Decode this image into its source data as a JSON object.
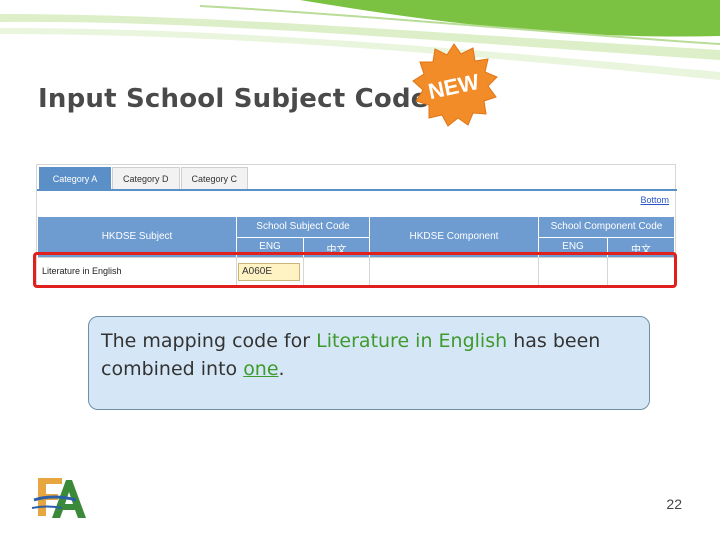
{
  "slide": {
    "title": "Input School Subject Code",
    "badge": "NEW",
    "page_number": "22"
  },
  "screen": {
    "tabs": [
      {
        "label": "Category A",
        "active": true
      },
      {
        "label": "Category D",
        "active": false
      },
      {
        "label": "Category C",
        "active": false
      }
    ],
    "bottom_link": "Bottom",
    "headers": {
      "hkdse_subject": "HKDSE Subject",
      "school_subject_code": "School Subject Code",
      "hkdse_component": "HKDSE Component",
      "school_component_code": "School Component Code",
      "eng": "ENG",
      "chi": "中文"
    },
    "row": {
      "subject": "Literature in English",
      "eng_code": "A060E"
    }
  },
  "callout": {
    "part1": "The mapping code for ",
    "subject": "Literature in English",
    "part2": " has been combined into ",
    "emphasis": "one",
    "part3": "."
  },
  "colors": {
    "accent_green": "#3f9a2e",
    "header_blue": "#6e9bd0",
    "highlight_red": "#e0201c",
    "callout_bg": "#d5e7f6"
  }
}
